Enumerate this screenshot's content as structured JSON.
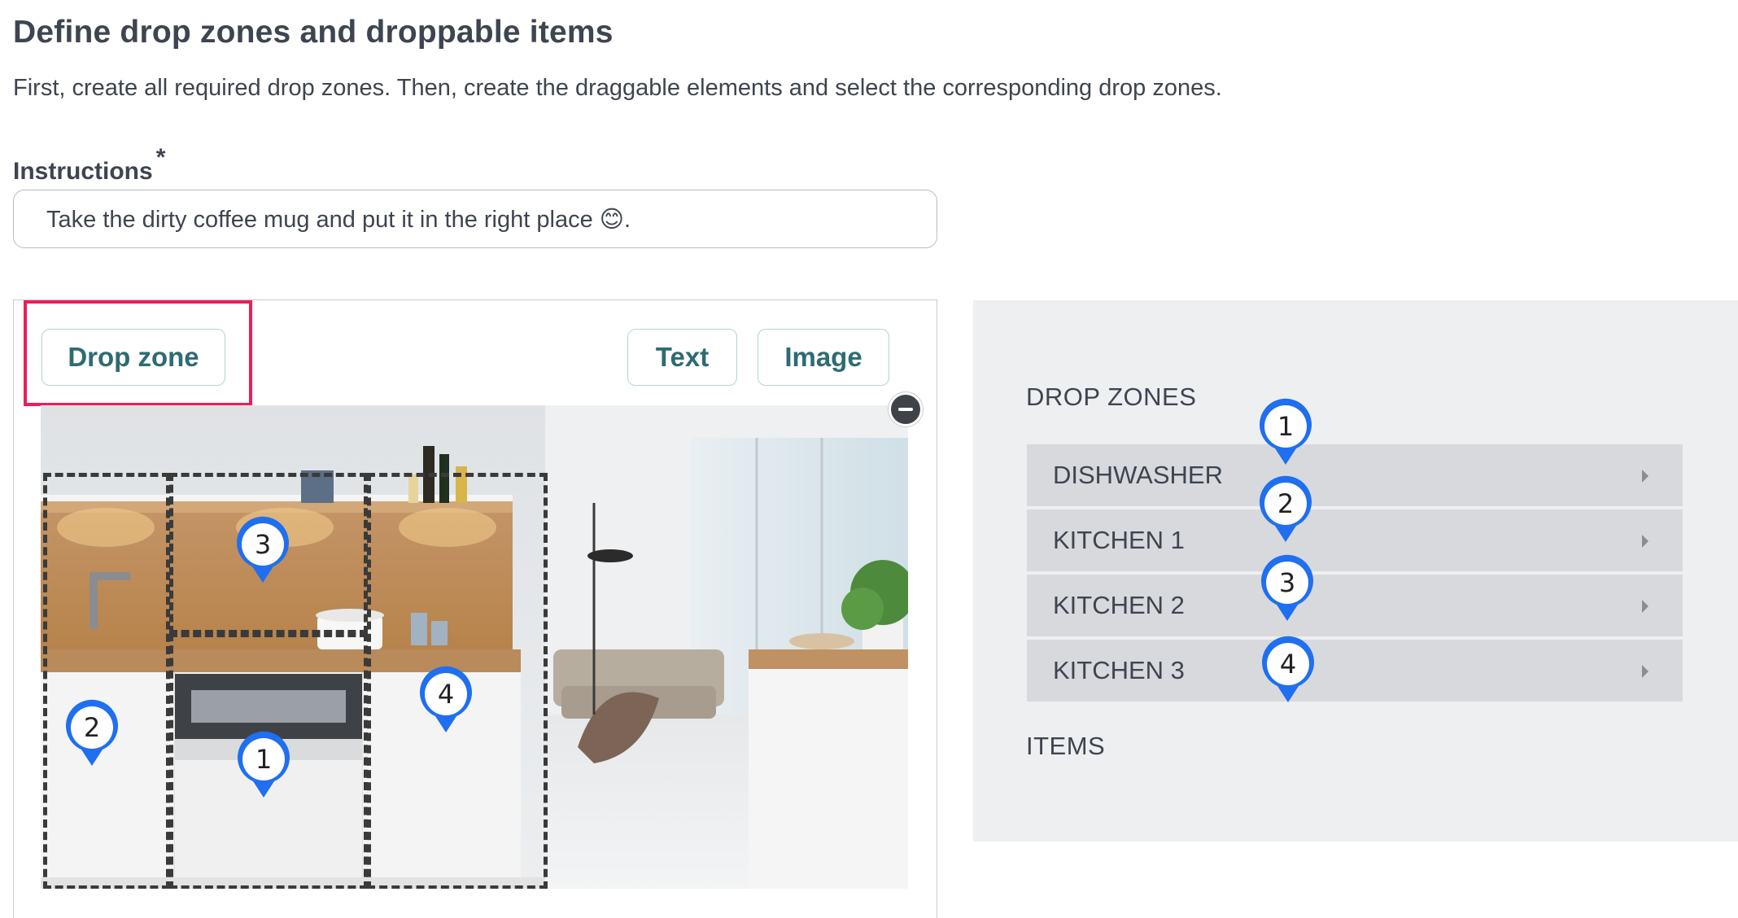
{
  "page": {
    "title": "Define drop zones and droppable items",
    "description": "First, create all required drop zones. Then, create the draggable elements and select the corresponding drop zones."
  },
  "instructions": {
    "label": "Instructions",
    "required_mark": "*",
    "value": "Take the dirty coffee mug and put it in the right place 😊."
  },
  "toolbar": {
    "drop_zone_label": "Drop zone",
    "text_label": "Text",
    "image_label": "Image",
    "highlight_color": "#ec1e59"
  },
  "canvas": {
    "image_subject": "kitchen-photo",
    "markers": [
      "1",
      "2",
      "3",
      "4"
    ]
  },
  "side_panel": {
    "drop_zones_heading": "DROP ZONES",
    "drop_zones": [
      {
        "label": "DISHWASHER",
        "marker": "1"
      },
      {
        "label": "KITCHEN 1",
        "marker": "2"
      },
      {
        "label": "KITCHEN 2",
        "marker": "3"
      },
      {
        "label": "KITCHEN 3",
        "marker": "4"
      }
    ],
    "items_heading": "ITEMS"
  },
  "colors": {
    "accent_teal": "#2e6b73",
    "marker_blue": "#1f6ff0",
    "panel_bg": "#eeeff1",
    "row_bg": "#d7d9dd"
  }
}
